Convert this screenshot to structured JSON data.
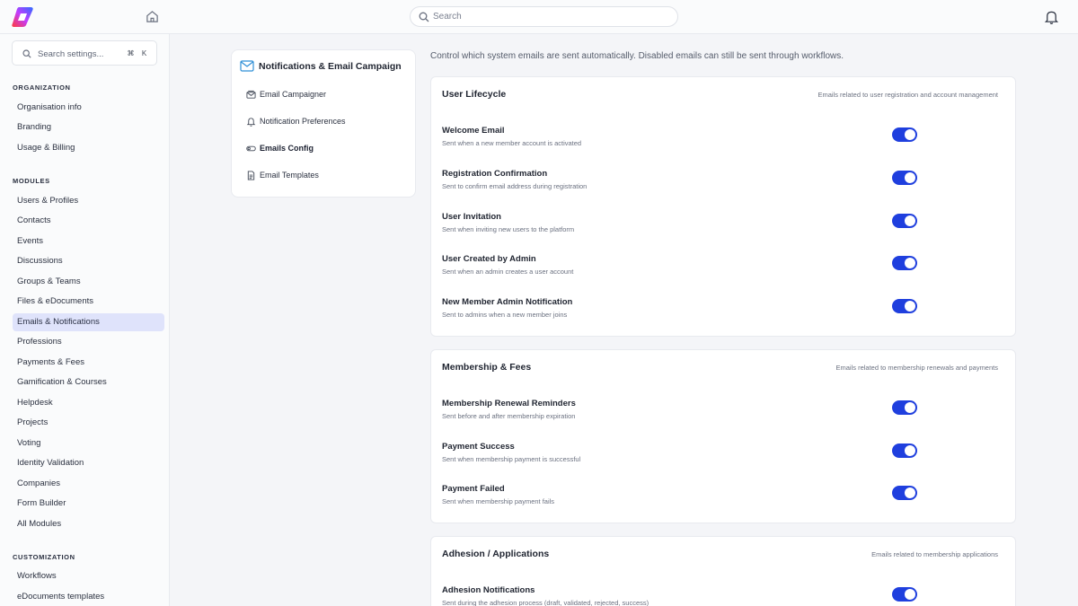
{
  "header": {
    "search_placeholder": "Search",
    "icons": [
      "app-logo",
      "home-icon",
      "search-icon",
      "bell-icon"
    ]
  },
  "sidebar": {
    "search_placeholder": "Search settings...",
    "shortcut": [
      "⌘",
      "K"
    ],
    "sections": [
      {
        "title": "ORGANIZATION",
        "items": [
          "Organisation info",
          "Branding",
          "Usage & Billing"
        ]
      },
      {
        "title": "MODULES",
        "items": [
          "Users & Profiles",
          "Contacts",
          "Events",
          "Discussions",
          "Groups & Teams",
          "Files & eDocuments",
          "Emails & Notifications",
          "Professions",
          "Payments & Fees",
          "Gamification & Courses",
          "Helpdesk",
          "Projects",
          "Voting",
          "Identity Validation",
          "Companies",
          "Form Builder",
          "All Modules"
        ]
      },
      {
        "title": "CUSTOMIZATION",
        "items": [
          "Workflows",
          "eDocuments templates"
        ]
      }
    ],
    "active_item": "Emails & Notifications"
  },
  "nav": {
    "title": "Notifications & Email Campaign",
    "items": [
      {
        "label": "Email Campaigner",
        "icon": "mail-stack-icon"
      },
      {
        "label": "Notification Preferences",
        "icon": "bell-icon"
      },
      {
        "label": "Emails Config",
        "icon": "toggle-icon",
        "active": true
      },
      {
        "label": "Email Templates",
        "icon": "document-icon"
      }
    ]
  },
  "main": {
    "intro": "Control which system emails are sent automatically. Disabled emails can still be sent through workflows.",
    "groups": [
      {
        "title": "User Lifecycle",
        "description": "Emails related to user registration and account management",
        "emails": [
          {
            "name": "Welcome Email",
            "description": "Sent when a new member account is activated",
            "enabled": true
          },
          {
            "name": "Registration Confirmation",
            "description": "Sent to confirm email address during registration",
            "enabled": true
          },
          {
            "name": "User Invitation",
            "description": "Sent when inviting new users to the platform",
            "enabled": true
          },
          {
            "name": "User Created by Admin",
            "description": "Sent when an admin creates a user account",
            "enabled": true
          },
          {
            "name": "New Member Admin Notification",
            "description": "Sent to admins when a new member joins",
            "enabled": true
          }
        ]
      },
      {
        "title": "Membership & Fees",
        "description": "Emails related to membership renewals and payments",
        "emails": [
          {
            "name": "Membership Renewal Reminders",
            "description": "Sent before and after membership expiration",
            "enabled": true
          },
          {
            "name": "Payment Success",
            "description": "Sent when membership payment is successful",
            "enabled": true
          },
          {
            "name": "Payment Failed",
            "description": "Sent when membership payment fails",
            "enabled": true
          }
        ]
      },
      {
        "title": "Adhesion / Applications",
        "description": "Emails related to membership applications",
        "emails": [
          {
            "name": "Adhesion Notifications",
            "description": "Sent during the adhesion process (draft, validated, rejected, success)",
            "enabled": true
          }
        ]
      }
    ]
  },
  "colors": {
    "accent": "#1f3fde",
    "active_bg": "#dfe3fb",
    "page_bg": "#f4f5f8"
  }
}
